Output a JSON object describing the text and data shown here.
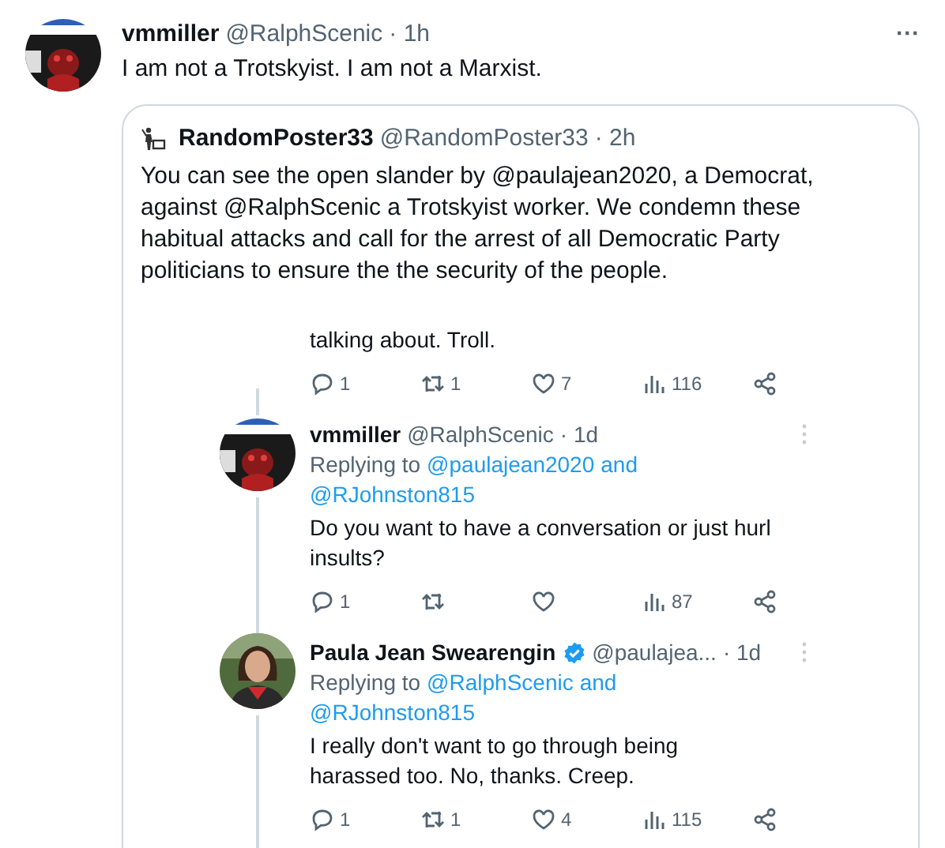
{
  "tweet": {
    "name": "vmmiller",
    "handle": "@RalphScenic",
    "time": "· 1h",
    "text": "I am not a Trotskyist. I am not a Marxist.",
    "more": "···"
  },
  "quote": {
    "name": "RandomPoster33",
    "handle": "@RandomPoster33",
    "time": "· 2h",
    "text": "You can see the open slander by @paulajean2020, a Democrat, against @RalphScenic a Trotskyist worker. We condemn these habitual attacks and call for the arrest of all Democratic Party politicians to ensure the the security of the people."
  },
  "screenshot": {
    "fragment": {
      "text": "talking about. Troll.",
      "actions": [
        {
          "kind": "reply",
          "count": "1"
        },
        {
          "kind": "retweet",
          "count": "1"
        },
        {
          "kind": "like",
          "count": "7"
        },
        {
          "kind": "views",
          "count": "116"
        },
        {
          "kind": "share"
        }
      ]
    },
    "replies": [
      {
        "name": "vmmiller",
        "handle": "@RalphScenic",
        "time": "· 1d",
        "replying_label": "Replying to",
        "mentions": [
          "@paulajean2020",
          "@RJohnston815"
        ],
        "joiner": "and",
        "text": "Do you want to have a conversation or just hurl insults?",
        "actions": [
          {
            "kind": "reply",
            "count": "1"
          },
          {
            "kind": "retweet"
          },
          {
            "kind": "like"
          },
          {
            "kind": "views",
            "count": "87"
          },
          {
            "kind": "share"
          }
        ]
      },
      {
        "name": "Paula Jean Swearengin",
        "verified": true,
        "handle": "@paulajea...",
        "time": "· 1d",
        "replying_label": "Replying to",
        "mentions": [
          "@RalphScenic",
          "@RJohnston815"
        ],
        "joiner": "and",
        "text": "I really don't want to go through being harassed too. No, thanks. Creep.",
        "actions": [
          {
            "kind": "reply",
            "count": "1"
          },
          {
            "kind": "retweet",
            "count": "1"
          },
          {
            "kind": "like",
            "count": "4"
          },
          {
            "kind": "views",
            "count": "115"
          },
          {
            "kind": "share"
          }
        ]
      }
    ]
  }
}
